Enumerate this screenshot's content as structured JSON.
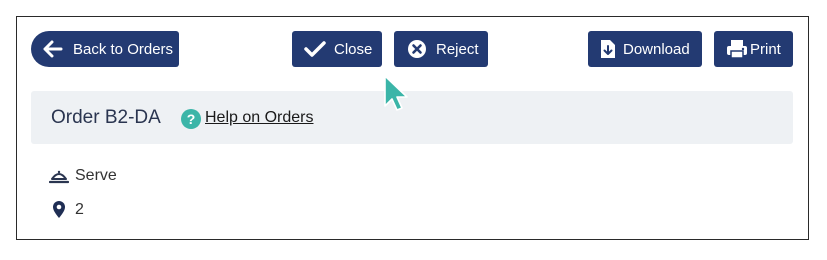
{
  "toolbar": {
    "back_label": "Back to Orders",
    "close_label": "Close",
    "reject_label": "Reject",
    "download_label": "Download",
    "print_label": "Print"
  },
  "header": {
    "order_title": "Order B2-DA",
    "help_link": "Help on Orders"
  },
  "details": {
    "service_label": "Serve",
    "location_value": "2"
  },
  "icons": {
    "back": "arrow-left-icon",
    "close": "checkmark-icon",
    "reject": "x-circle-icon",
    "download": "file-download-icon",
    "print": "printer-icon",
    "help": "question-circle-icon",
    "service": "serving-bell-icon",
    "location": "map-pin-icon",
    "cursor": "mouse-cursor-icon"
  },
  "colors": {
    "button_bg": "#233a72",
    "panel_bg": "#eef1f4",
    "help_icon": "#3bb5a8",
    "cursor": "#3bb5a8"
  }
}
